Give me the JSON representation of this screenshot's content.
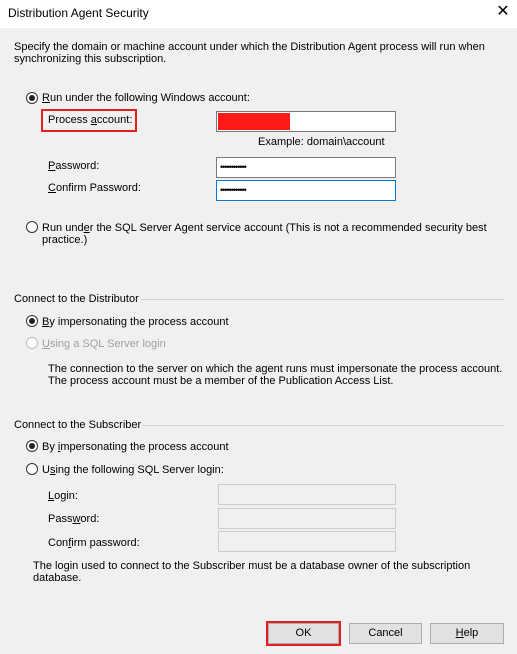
{
  "window": {
    "title": "Distribution Agent Security",
    "close_icon": "close-icon"
  },
  "intro": {
    "line1": "Specify the domain or machine account under which the Distribution Agent process will run when",
    "line2": "synchronizing this subscription."
  },
  "run_as": {
    "windows_account_option": {
      "pre": "",
      "key": "R",
      "post": "un under the following Windows account:",
      "selected": true
    },
    "process_account": {
      "pre": "Process ",
      "key": "a",
      "post": "ccount:",
      "value": ""
    },
    "example": "Example: domain\\account",
    "password": {
      "pre": "",
      "key": "P",
      "post": "assword:",
      "value": "••••••••••••"
    },
    "confirm_password": {
      "pre": "",
      "key": "C",
      "post": "onfirm Password:",
      "value": "••••••••••••"
    },
    "sql_agent_option": {
      "pre": "Run und",
      "key": "e",
      "post": "r the SQL Server Agent service account (This is not a recommended security best",
      "line2": "practice.)",
      "selected": false
    }
  },
  "distributor": {
    "group_label": "Connect to the Distributor",
    "impersonate_option": {
      "pre": "",
      "key": "B",
      "post": "y impersonating the process account",
      "selected": true
    },
    "sql_login_option": {
      "pre": "",
      "key": "U",
      "post": "sing a SQL Server login",
      "selected": false,
      "enabled": false
    },
    "note_line1": "The connection to the server on which the agent runs must impersonate the process account.",
    "note_line2": "The process account must be a member of the Publication Access List."
  },
  "subscriber": {
    "group_label": "Connect to the Subscriber",
    "impersonate_option": {
      "pre": "By ",
      "key": "i",
      "post": "mpersonating the process account",
      "selected": true
    },
    "sql_login_option": {
      "pre": "U",
      "key": "s",
      "post": "ing the following SQL Server login:",
      "selected": false
    },
    "login": {
      "pre": "",
      "key": "L",
      "post": "ogin:",
      "value": ""
    },
    "password": {
      "pre": "Pass",
      "key": "w",
      "post": "ord:",
      "value": ""
    },
    "confirm_password": {
      "pre": "Con",
      "key": "f",
      "post": "irm password:",
      "value": ""
    },
    "note_line1": "The login used to connect to the Subscriber must be a database owner of the subscription",
    "note_line2": "database."
  },
  "buttons": {
    "ok": "OK",
    "cancel": "Cancel",
    "help": {
      "pre": "",
      "key": "H",
      "post": "elp"
    }
  },
  "colors": {
    "highlight": "#e0201f",
    "redacted": "#ff1a1a",
    "focus": "#0078d7"
  }
}
